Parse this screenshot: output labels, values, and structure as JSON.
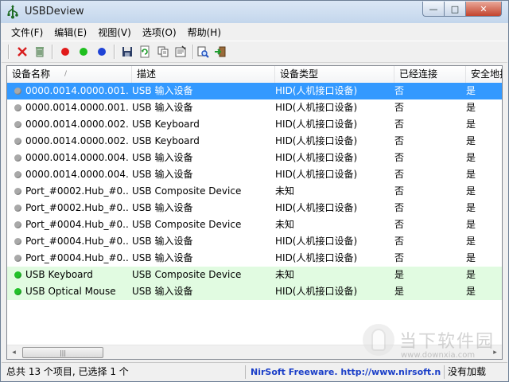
{
  "window": {
    "title": "USBDeview"
  },
  "title_buttons": {
    "minimize": "—",
    "maximize": "□",
    "close": "✕"
  },
  "menu": [
    "文件(F)",
    "编辑(E)",
    "视图(V)",
    "选项(O)",
    "帮助(H)"
  ],
  "toolbar": {
    "buttons": [
      "disconnect-icon",
      "uninstall-icon",
      "red-dot-icon",
      "green-dot-icon",
      "blue-dot-icon",
      "save-icon",
      "refresh-icon",
      "copy-icon",
      "properties-icon",
      "find-icon",
      "exit-icon"
    ]
  },
  "colors": {
    "selection": "#3399ff",
    "connected_row": "#e1fbe1",
    "connected_dot": "#22c12a",
    "disconnected_dot": "#a9a9a9"
  },
  "table": {
    "columns": [
      "设备名称",
      "描述",
      "设备类型",
      "已经连接",
      "安全地拔"
    ],
    "sort_indicator": "/",
    "rows": [
      {
        "name": "0000.0014.0000.001....",
        "desc": "USB 输入设备",
        "type": "HID(人机接口设备)",
        "connected": "否",
        "safe": "是",
        "state": "selected"
      },
      {
        "name": "0000.0014.0000.001....",
        "desc": "USB 输入设备",
        "type": "HID(人机接口设备)",
        "connected": "否",
        "safe": "是",
        "state": "disconnected"
      },
      {
        "name": "0000.0014.0000.002....",
        "desc": "USB Keyboard",
        "type": "HID(人机接口设备)",
        "connected": "否",
        "safe": "是",
        "state": "disconnected"
      },
      {
        "name": "0000.0014.0000.002....",
        "desc": "USB Keyboard",
        "type": "HID(人机接口设备)",
        "connected": "否",
        "safe": "是",
        "state": "disconnected"
      },
      {
        "name": "0000.0014.0000.004....",
        "desc": "USB 输入设备",
        "type": "HID(人机接口设备)",
        "connected": "否",
        "safe": "是",
        "state": "disconnected"
      },
      {
        "name": "0000.0014.0000.004....",
        "desc": "USB 输入设备",
        "type": "HID(人机接口设备)",
        "connected": "否",
        "safe": "是",
        "state": "disconnected"
      },
      {
        "name": "Port_#0002.Hub_#0...",
        "desc": "USB Composite Device",
        "type": "未知",
        "connected": "否",
        "safe": "是",
        "state": "disconnected"
      },
      {
        "name": "Port_#0002.Hub_#0...",
        "desc": "USB 输入设备",
        "type": "HID(人机接口设备)",
        "connected": "否",
        "safe": "是",
        "state": "disconnected"
      },
      {
        "name": "Port_#0004.Hub_#0...",
        "desc": "USB Composite Device",
        "type": "未知",
        "connected": "否",
        "safe": "是",
        "state": "disconnected"
      },
      {
        "name": "Port_#0004.Hub_#0...",
        "desc": "USB 输入设备",
        "type": "HID(人机接口设备)",
        "connected": "否",
        "safe": "是",
        "state": "disconnected"
      },
      {
        "name": "Port_#0004.Hub_#0...",
        "desc": "USB 输入设备",
        "type": "HID(人机接口设备)",
        "connected": "否",
        "safe": "是",
        "state": "disconnected"
      },
      {
        "name": "USB Keyboard",
        "desc": "USB Composite Device",
        "type": "未知",
        "connected": "是",
        "safe": "是",
        "state": "connected"
      },
      {
        "name": "USB Optical Mouse",
        "desc": "USB 输入设备",
        "type": "HID(人机接口设备)",
        "connected": "是",
        "safe": "是",
        "state": "connected"
      }
    ]
  },
  "scrollbar": {
    "left_arrow": "◂",
    "thumb_grip": "|||",
    "right_arrow": "▸"
  },
  "statusbar": {
    "count": "总共 13 个项目, 已选择 1 个",
    "link": "NirSoft Freeware.  http://www.nirsoft.net",
    "right": "没有加载"
  },
  "watermark": {
    "text": "当下软件园",
    "url": "www.downxia.com"
  }
}
